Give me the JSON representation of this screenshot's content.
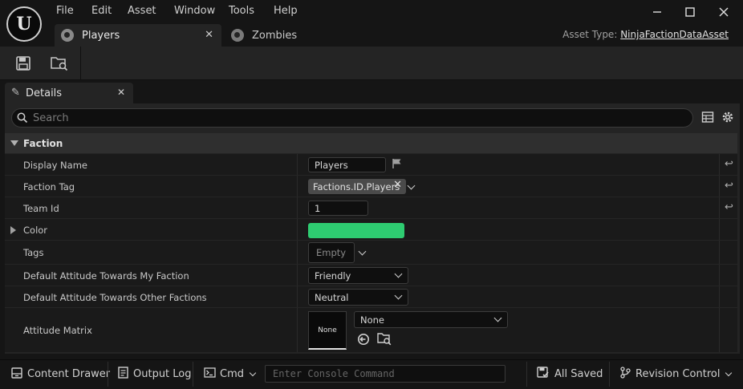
{
  "menu": [
    "File",
    "Edit",
    "Asset",
    "Window",
    "Tools",
    "Help"
  ],
  "tabs": [
    {
      "label": "Players",
      "active": true
    },
    {
      "label": "Zombies",
      "active": false
    }
  ],
  "asset_type": {
    "label": "Asset Type:",
    "value": "NinjaFactionDataAsset"
  },
  "details_tab": {
    "label": "Details"
  },
  "search": {
    "placeholder": "Search"
  },
  "category": {
    "label": "Faction"
  },
  "properties": {
    "display_name": {
      "label": "Display Name",
      "value": "Players"
    },
    "faction_tag": {
      "label": "Faction Tag",
      "value": "Factions.ID.Players"
    },
    "team_id": {
      "label": "Team Id",
      "value": "1"
    },
    "color": {
      "label": "Color",
      "value": "#2ecc71"
    },
    "tags": {
      "label": "Tags",
      "value": "Empty"
    },
    "attitude_my": {
      "label": "Default Attitude Towards My Faction",
      "value": "Friendly"
    },
    "attitude_other": {
      "label": "Default Attitude Towards Other Factions",
      "value": "Neutral"
    },
    "attitude_matrix": {
      "label": "Attitude Matrix",
      "thumb": "None",
      "value": "None"
    }
  },
  "statusbar": {
    "content_drawer": "Content Drawer",
    "output_log": "Output Log",
    "cmd": "Cmd",
    "console_placeholder": "Enter Console Command",
    "all_saved": "All Saved",
    "revision_control": "Revision Control"
  }
}
